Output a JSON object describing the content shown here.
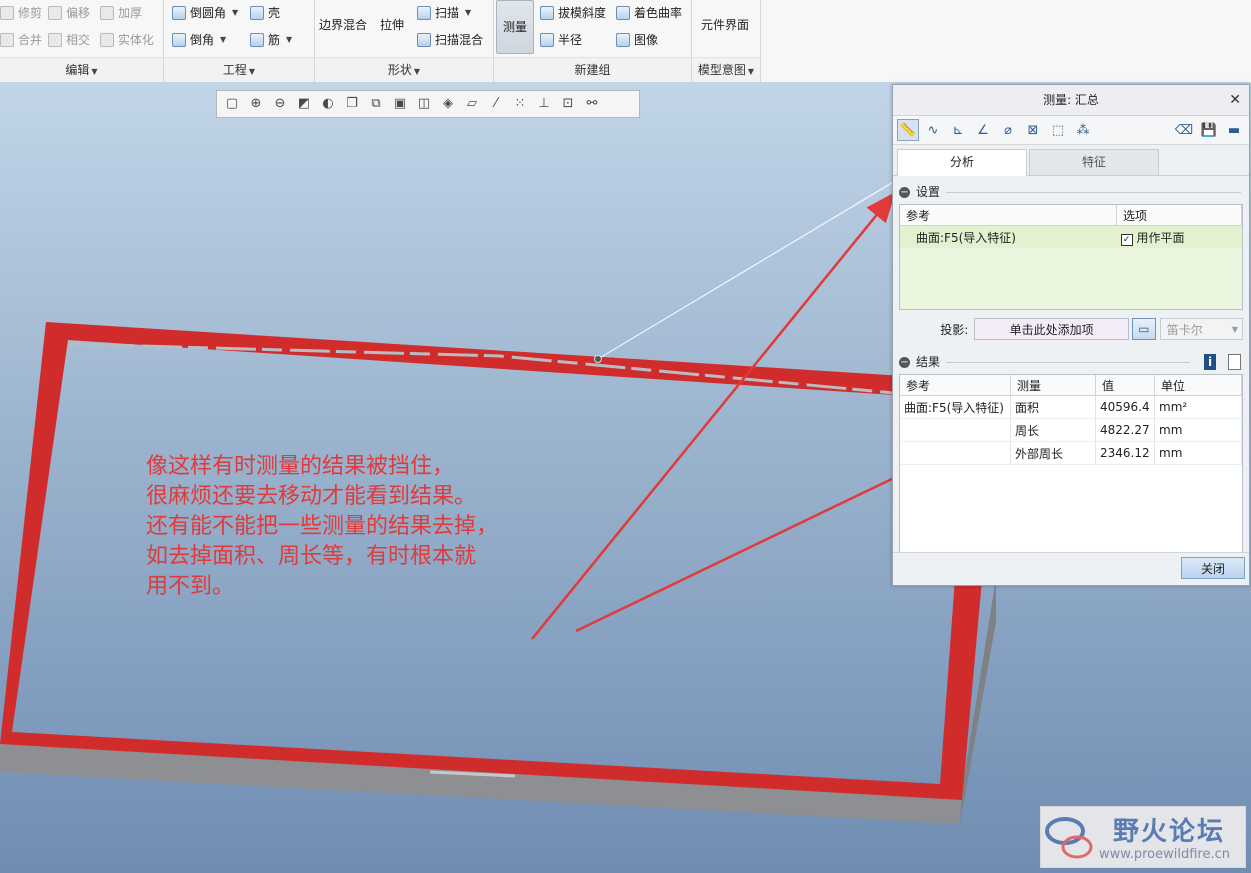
{
  "ribbon": {
    "groups": [
      {
        "label": "编辑",
        "buttons": [
          "修剪",
          "偏移",
          "加厚",
          "合并",
          "相交",
          "实体化"
        ]
      },
      {
        "label": "工程",
        "buttons": [
          "倒圆角",
          "壳",
          "倒角",
          "筋"
        ]
      },
      {
        "label": "形状",
        "buttons": [
          "边界混合",
          "拉伸",
          "扫描",
          "扫描混合"
        ]
      },
      {
        "label": "新建组",
        "buttons": [
          "测量",
          "拔模斜度",
          "着色曲率",
          "半径",
          "图像"
        ]
      },
      {
        "label": "模型意图",
        "buttons": [
          "元件界面"
        ]
      }
    ]
  },
  "view_toolbar": {
    "icons": [
      "refit-icon",
      "zoom-in-icon",
      "zoom-out-icon",
      "repaint-icon",
      "display-style-icon",
      "view-manager-icon",
      "saved-orientations-icon",
      "named-views-icon",
      "perspective-icon",
      "spin-center-icon",
      "plane-display-icon",
      "axis-display-icon",
      "point-display-icon",
      "csys-display-icon",
      "annotation-display-icon",
      "sketch-display-icon"
    ]
  },
  "annotation": {
    "lines": [
      "像这样有时测量的结果被挡住，",
      "很麻烦还要去移动才能看到结果。",
      "还有能不能把一些测量的结果去掉，",
      "如去掉面积、周长等，有时根本就",
      "用不到。"
    ],
    "color": "#e03a3a"
  },
  "dialog": {
    "title": "测量: 汇总",
    "tabs": [
      "分析",
      "特征"
    ],
    "settings": {
      "header": "设置",
      "columns": [
        "参考",
        "选项"
      ],
      "rows": [
        {
          "ref": "曲面:F5(导入特征)",
          "option": "用作平面",
          "checked": true
        }
      ]
    },
    "projection": {
      "label": "投影:",
      "placeholder": "单击此处添加项",
      "coord_system": "笛卡尔"
    },
    "results": {
      "header": "结果",
      "columns": [
        "参考",
        "测量",
        "值",
        "单位"
      ],
      "rows": [
        {
          "ref": "曲面:F5(导入特征)",
          "measure": "面积",
          "value": "40596.4",
          "unit": "mm²"
        },
        {
          "ref": "",
          "measure": "周长",
          "value": "4822.27",
          "unit": "mm"
        },
        {
          "ref": "",
          "measure": "外部周长",
          "value": "2346.12",
          "unit": "mm"
        }
      ]
    },
    "close_label": "关闭"
  },
  "watermark": {
    "title": "野火论坛",
    "url": "www.proewildfire.cn"
  }
}
